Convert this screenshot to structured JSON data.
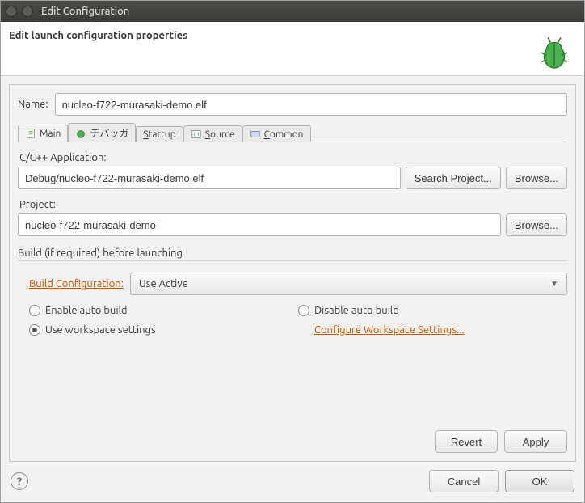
{
  "window": {
    "title": "Edit Configuration"
  },
  "header": {
    "title": "Edit launch configuration properties"
  },
  "name": {
    "label": "Name:",
    "value": "nucleo-f722-murasaki-demo.elf"
  },
  "tabs": {
    "main": "Main",
    "debugger": "デバッガ",
    "startup": "Startup",
    "source": "Source",
    "common": "Common"
  },
  "app": {
    "label": "C/C++ Application:",
    "value": "Debug/nucleo-f722-murasaki-demo.elf",
    "searchProject": "Search Project...",
    "browse": "Browse..."
  },
  "project": {
    "label": "Project:",
    "value": "nucleo-f722-murasaki-demo",
    "browse": "Browse..."
  },
  "build": {
    "groupLabel": "Build (if required) before launching",
    "configLabel": "Build Configuration:",
    "configValue": "Use Active",
    "enableAuto": "Enable auto build",
    "disableAuto": "Disable auto build",
    "useWorkspace": "Use workspace settings",
    "configureLink": "Configure Workspace Settings..."
  },
  "buttons": {
    "revert": "Revert",
    "apply": "Apply",
    "cancel": "Cancel",
    "ok": "OK"
  }
}
